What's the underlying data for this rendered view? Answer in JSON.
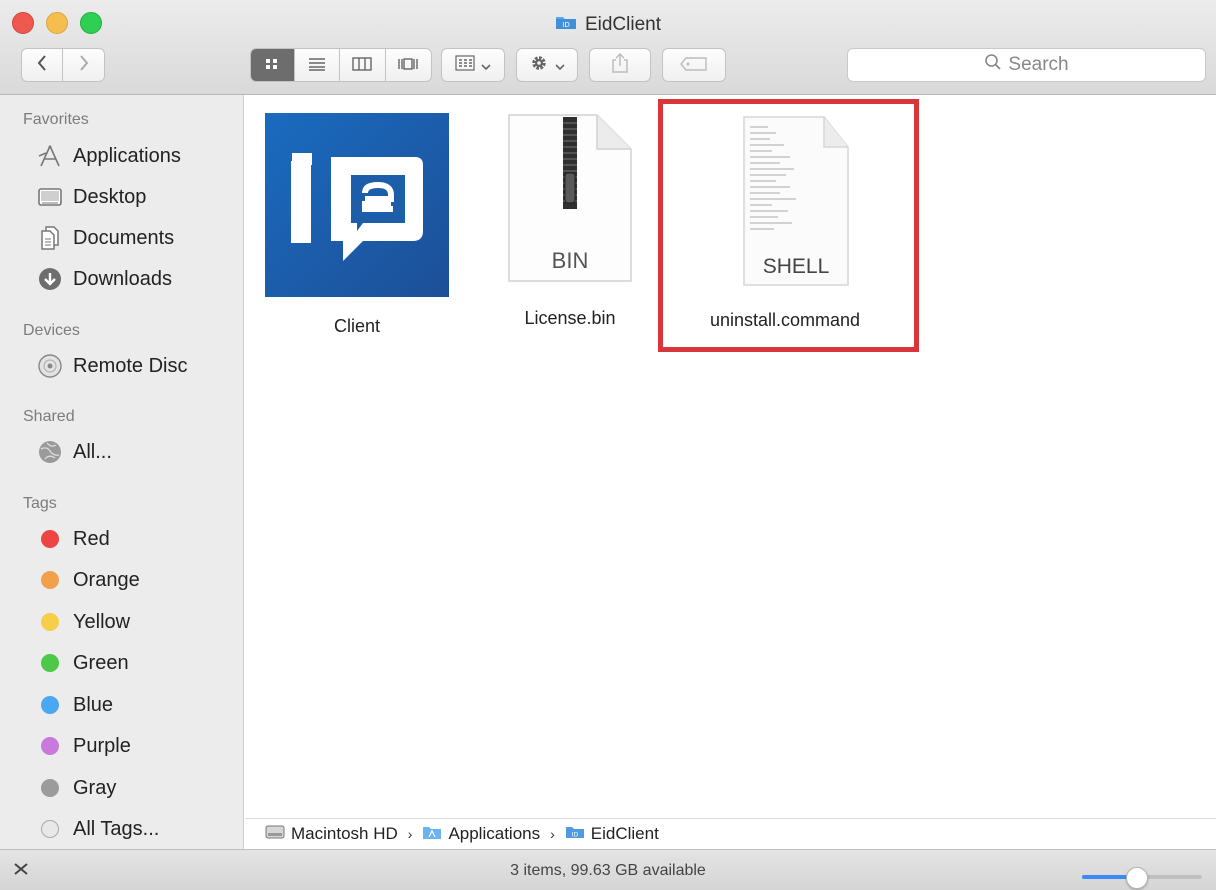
{
  "window": {
    "title": "EidClient",
    "traffic_lights": {
      "close": "#ed594f",
      "minimize": "#f6be4f",
      "zoom": "#2ecf53"
    }
  },
  "toolbar": {
    "back_icon": "chevron-left-icon",
    "forward_icon": "chevron-right-icon",
    "view_modes": [
      "icon-view-icon",
      "list-view-icon",
      "column-view-icon",
      "cover-flow-icon"
    ],
    "search_placeholder": "Search"
  },
  "sidebar": {
    "favorites_header": "Favorites",
    "favorites": [
      {
        "label": "Applications",
        "icon": "applications-icon"
      },
      {
        "label": "Desktop",
        "icon": "desktop-icon"
      },
      {
        "label": "Documents",
        "icon": "documents-icon"
      },
      {
        "label": "Downloads",
        "icon": "downloads-icon"
      }
    ],
    "devices_header": "Devices",
    "devices": [
      {
        "label": "Remote Disc",
        "icon": "disc-icon"
      }
    ],
    "shared_header": "Shared",
    "shared": [
      {
        "label": "All...",
        "icon": "network-icon"
      }
    ],
    "tags_header": "Tags",
    "tags": [
      {
        "label": "Red",
        "color": "#ed4444"
      },
      {
        "label": "Orange",
        "color": "#f3a04a"
      },
      {
        "label": "Yellow",
        "color": "#f6ce4a"
      },
      {
        "label": "Green",
        "color": "#4cc948"
      },
      {
        "label": "Blue",
        "color": "#48a9f2"
      },
      {
        "label": "Purple",
        "color": "#c978dc"
      },
      {
        "label": "Gray",
        "color": "#9b9b9b"
      },
      {
        "label": "All Tags...",
        "color": "#dcdcdc"
      }
    ]
  },
  "files": [
    {
      "name": "Client",
      "kind": "app"
    },
    {
      "name": "License.bin",
      "kind": "zip",
      "badge": "BIN"
    },
    {
      "name": "uninstall.command",
      "kind": "shell",
      "badge": "SHELL"
    }
  ],
  "highlight_color": "#d9363b",
  "pathbar": {
    "items": [
      "Macintosh HD",
      "Applications",
      "EidClient"
    ]
  },
  "status": {
    "text": "3 items, 99.63 GB available",
    "zoom_fraction": 0.45,
    "accent": "#3a8bf6"
  }
}
